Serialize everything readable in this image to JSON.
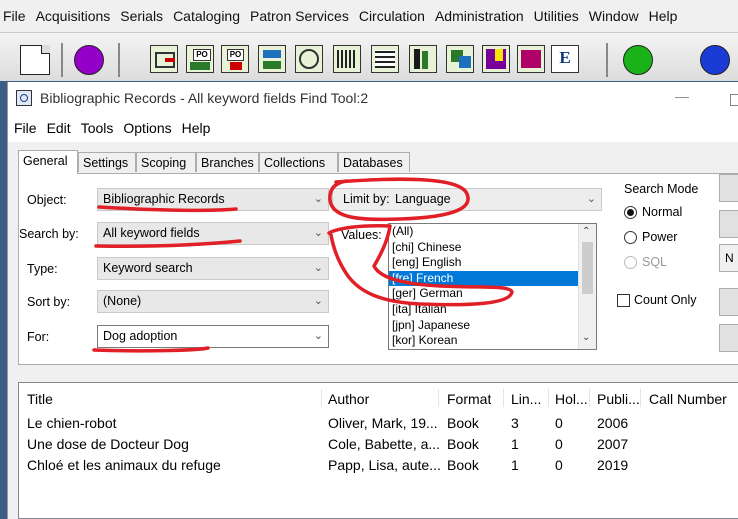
{
  "main_menu": [
    "File",
    "Acquisitions",
    "Serials",
    "Cataloging",
    "Patron Services",
    "Circulation",
    "Administration",
    "Utilities",
    "Window",
    "Help"
  ],
  "toolbar": {
    "icons": [
      "new-document-icon",
      "purple-circle-icon",
      "acquisitions-icon",
      "po-icon",
      "po-receive-icon",
      "invoice-icon",
      "routing-icon",
      "barcode-icon",
      "serials-icon",
      "books-icon",
      "checklist-icon",
      "cataloging-icon",
      "editor-icon",
      "green-circle-icon",
      "blue-circle-icon"
    ],
    "editor_letter": "E",
    "po_label": "PO"
  },
  "window": {
    "title": "Bibliographic Records - All keyword fields Find Tool:2",
    "minimize": "—",
    "menu": [
      "File",
      "Edit",
      "Tools",
      "Options",
      "Help"
    ],
    "tabs": [
      "General",
      "Settings",
      "Scoping",
      "Branches",
      "Collections",
      "Databases"
    ],
    "form": {
      "object_label": "Object:",
      "object_value": "Bibliographic Records",
      "searchby_label": "Search by:",
      "searchby_value": "All keyword fields",
      "type_label": "Type:",
      "type_value": "Keyword search",
      "sortby_label": "Sort by:",
      "sortby_value": "(None)",
      "for_label": "For:",
      "for_value": "Dog adoption",
      "limitby_label": "Limit by:",
      "limitby_value": "Language",
      "values_label": "Values:",
      "values_options": [
        "(All)",
        "[chi] Chinese",
        "[eng] English",
        "[fre] French",
        "[ger] German",
        "[ita] Italian",
        "[jpn] Japanese",
        "[kor] Korean"
      ],
      "values_selected": "[fre] French"
    },
    "search_mode": {
      "title": "Search Mode",
      "options": [
        "Normal",
        "Power",
        "SQL"
      ],
      "selected": "Normal"
    },
    "count_only": "Count Only",
    "side_button_letter": "N",
    "results": {
      "headers": [
        "Title",
        "Author",
        "Format",
        "Lin...",
        "Hol...",
        "Publi...",
        "Call Number"
      ],
      "rows": [
        [
          "Le chien-robot",
          "Oliver, Mark, 19...",
          "Book",
          "3",
          "0",
          "2006",
          ""
        ],
        [
          "Une dose de Docteur Dog",
          "Cole, Babette, a...",
          "Book",
          "1",
          "0",
          "2007",
          ""
        ],
        [
          "Chloé et les animaux du refuge",
          "Papp, Lisa, aute...",
          "Book",
          "1",
          "0",
          "2019",
          ""
        ]
      ]
    }
  },
  "colors": {
    "annotation": "#e01f26",
    "selection": "#0078d7",
    "desktop": "#3a5e86"
  }
}
